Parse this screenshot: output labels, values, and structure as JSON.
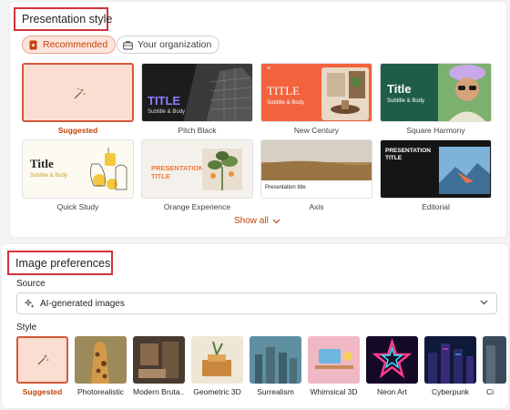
{
  "presentation_style": {
    "title": "Presentation style",
    "tabs": [
      {
        "label": "Recommended",
        "icon": "recommended-icon",
        "selected": true
      },
      {
        "label": "Your organization",
        "icon": "briefcase-icon",
        "selected": false
      }
    ],
    "themes": [
      {
        "label": "Suggested",
        "selected": true
      },
      {
        "label": "Pitch Black",
        "thumb_title": "TITLE",
        "thumb_subtitle": "Subtitle & Body"
      },
      {
        "label": "New Century",
        "thumb_title": "TITLE",
        "thumb_subtitle": "Subtitle & Body"
      },
      {
        "label": "Square Harmony",
        "thumb_title": "Title",
        "thumb_subtitle": "Subtitle & Body"
      },
      {
        "label": "Quick Study",
        "thumb_title": "Title",
        "thumb_subtitle": "Subtitle & Body"
      },
      {
        "label": "Orange Experience",
        "thumb_title": "PRESENTATION TITLE"
      },
      {
        "label": "Axis",
        "thumb_title": "Presentation title"
      },
      {
        "label": "Editorial",
        "thumb_title": "PRESENTATION TITLE"
      }
    ],
    "show_all": "Show all"
  },
  "image_preferences": {
    "title": "Image preferences",
    "source_label": "Source",
    "source_value": "AI-generated images",
    "style_label": "Style",
    "styles": [
      {
        "label": "Suggested",
        "selected": true
      },
      {
        "label": "Photorealistic"
      },
      {
        "label": "Modern Bruta..."
      },
      {
        "label": "Geometric 3D"
      },
      {
        "label": "Surrealism"
      },
      {
        "label": "Whimsical 3D"
      },
      {
        "label": "Neon Art"
      },
      {
        "label": "Cyberpunk"
      },
      {
        "label": "Ci"
      }
    ]
  },
  "colors": {
    "accent": "#c2430a",
    "highlight_box": "#d13438",
    "selected_fill": "#fbded2"
  }
}
